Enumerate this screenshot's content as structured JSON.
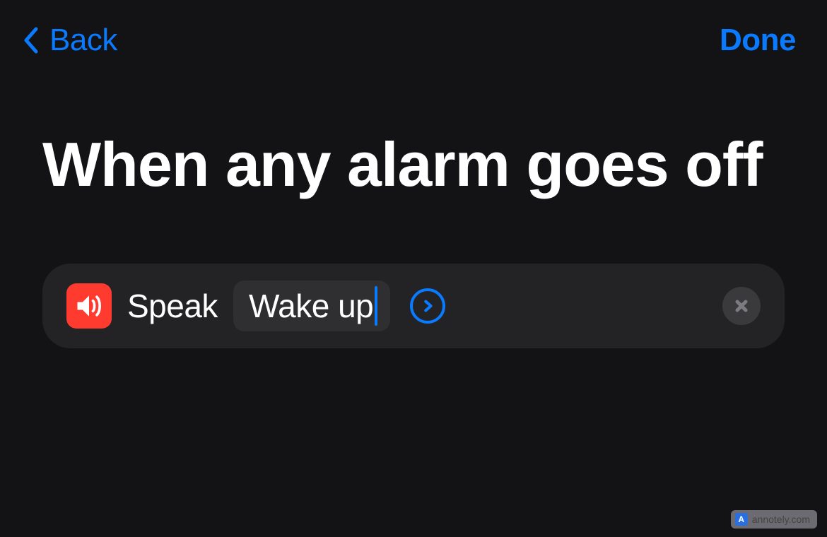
{
  "nav": {
    "back_label": "Back",
    "done_label": "Done"
  },
  "title": "When any alarm goes off",
  "action": {
    "speak_label": "Speak",
    "text_value": "Wake up"
  },
  "watermark": {
    "logo_letter": "A",
    "text": "annotely.com"
  }
}
